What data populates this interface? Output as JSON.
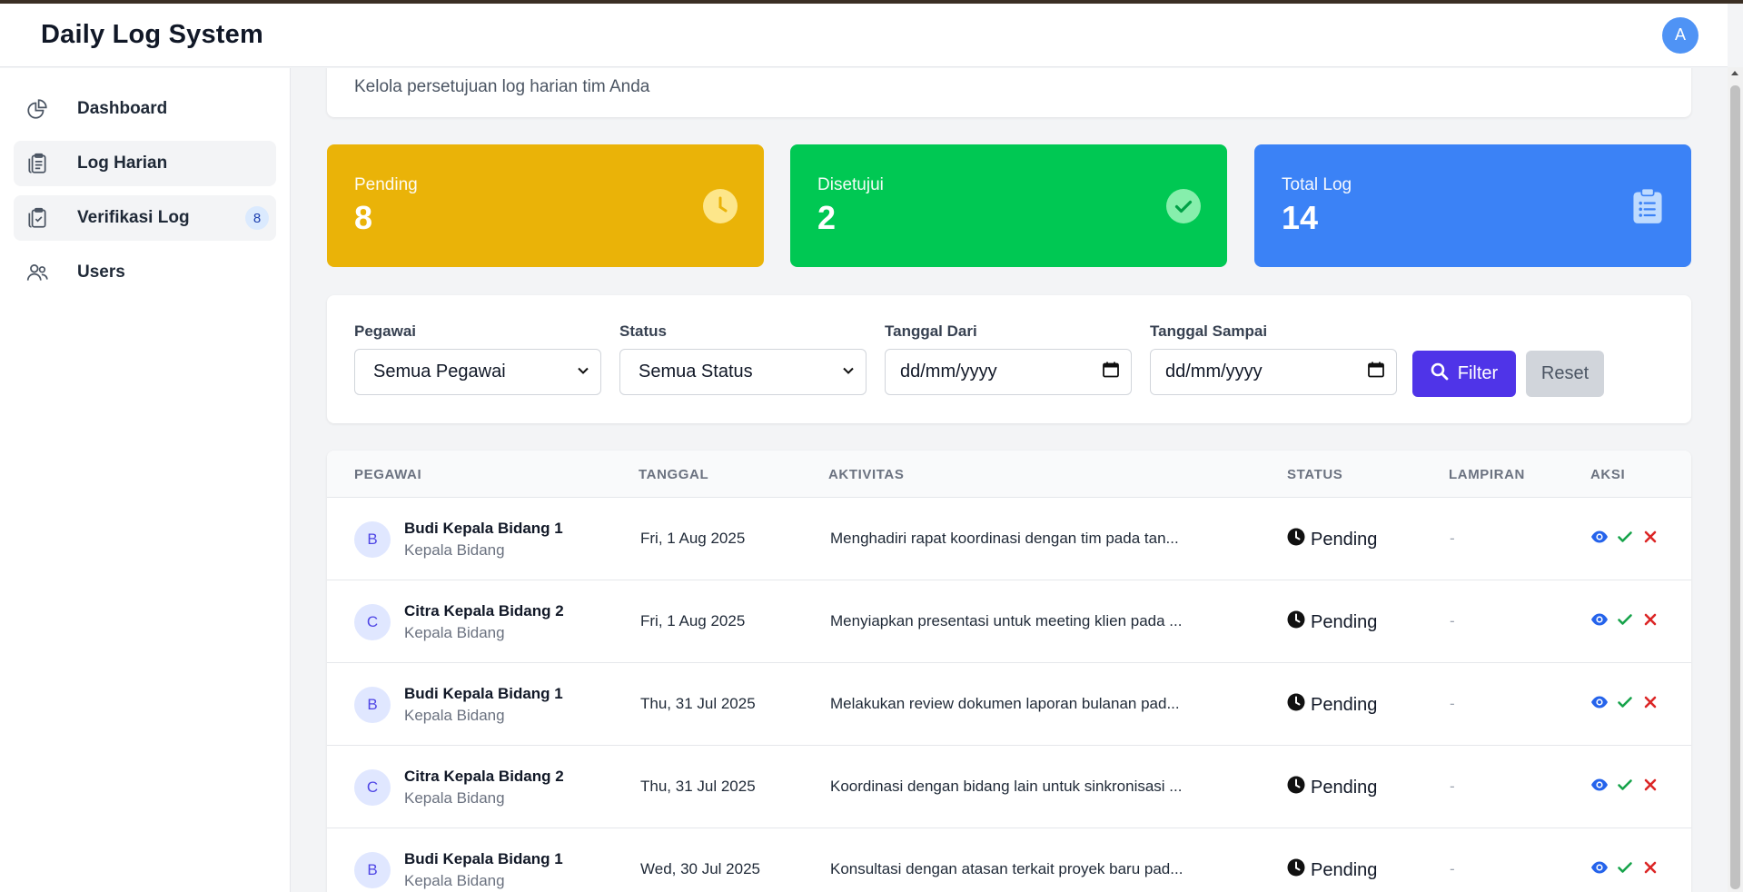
{
  "app": {
    "title": "Daily Log System",
    "avatar_letter": "A"
  },
  "sidebar": {
    "items": [
      {
        "label": "Dashboard",
        "icon": "chart-pie-icon",
        "active": false
      },
      {
        "label": "Log Harian",
        "icon": "clipboard-list-icon",
        "active": true
      },
      {
        "label": "Verifikasi Log",
        "icon": "clipboard-check-icon",
        "active": true,
        "badge": "8"
      },
      {
        "label": "Users",
        "icon": "users-icon",
        "active": false
      }
    ]
  },
  "page": {
    "subtitle": "Kelola persetujuan log harian tim Anda"
  },
  "stats": [
    {
      "label": "Pending",
      "value": "8",
      "icon": "clock-icon",
      "color": "#eab308"
    },
    {
      "label": "Disetujui",
      "value": "2",
      "icon": "check-circle-icon",
      "color": "#00c853"
    },
    {
      "label": "Total Log",
      "value": "14",
      "icon": "clipboard-list-icon",
      "color": "#3b82f6"
    }
  ],
  "filters": {
    "pegawai_label": "Pegawai",
    "pegawai_value": "Semua Pegawai",
    "status_label": "Status",
    "status_value": "Semua Status",
    "date_from_label": "Tanggal Dari",
    "date_from_placeholder": "dd/mm/yyyy",
    "date_to_label": "Tanggal Sampai",
    "date_to_placeholder": "dd/mm/yyyy",
    "filter_button": "Filter",
    "reset_button": "Reset"
  },
  "table": {
    "columns": [
      "PEGAWAI",
      "TANGGAL",
      "AKTIVITAS",
      "STATUS",
      "LAMPIRAN",
      "AKSI"
    ],
    "rows": [
      {
        "initial": "B",
        "name": "Budi Kepala Bidang 1",
        "role": "Kepala Bidang",
        "date": "Fri, 1 Aug 2025",
        "activity": "Menghadiri rapat koordinasi dengan tim pada tan...",
        "status": "Pending",
        "attachment": "-"
      },
      {
        "initial": "C",
        "name": "Citra Kepala Bidang 2",
        "role": "Kepala Bidang",
        "date": "Fri, 1 Aug 2025",
        "activity": "Menyiapkan presentasi untuk meeting klien pada ...",
        "status": "Pending",
        "attachment": "-"
      },
      {
        "initial": "B",
        "name": "Budi Kepala Bidang 1",
        "role": "Kepala Bidang",
        "date": "Thu, 31 Jul 2025",
        "activity": "Melakukan review dokumen laporan bulanan pad...",
        "status": "Pending",
        "attachment": "-"
      },
      {
        "initial": "C",
        "name": "Citra Kepala Bidang 2",
        "role": "Kepala Bidang",
        "date": "Thu, 31 Jul 2025",
        "activity": "Koordinasi dengan bidang lain untuk sinkronisasi ...",
        "status": "Pending",
        "attachment": "-"
      },
      {
        "initial": "B",
        "name": "Budi Kepala Bidang 1",
        "role": "Kepala Bidang",
        "date": "Wed, 30 Jul 2025",
        "activity": "Konsultasi dengan atasan terkait proyek baru pad...",
        "status": "Pending",
        "attachment": "-"
      }
    ]
  },
  "colors": {
    "primary": "#4f34e8",
    "view": "#2563eb",
    "approve": "#16a34a",
    "reject": "#dc2626"
  }
}
